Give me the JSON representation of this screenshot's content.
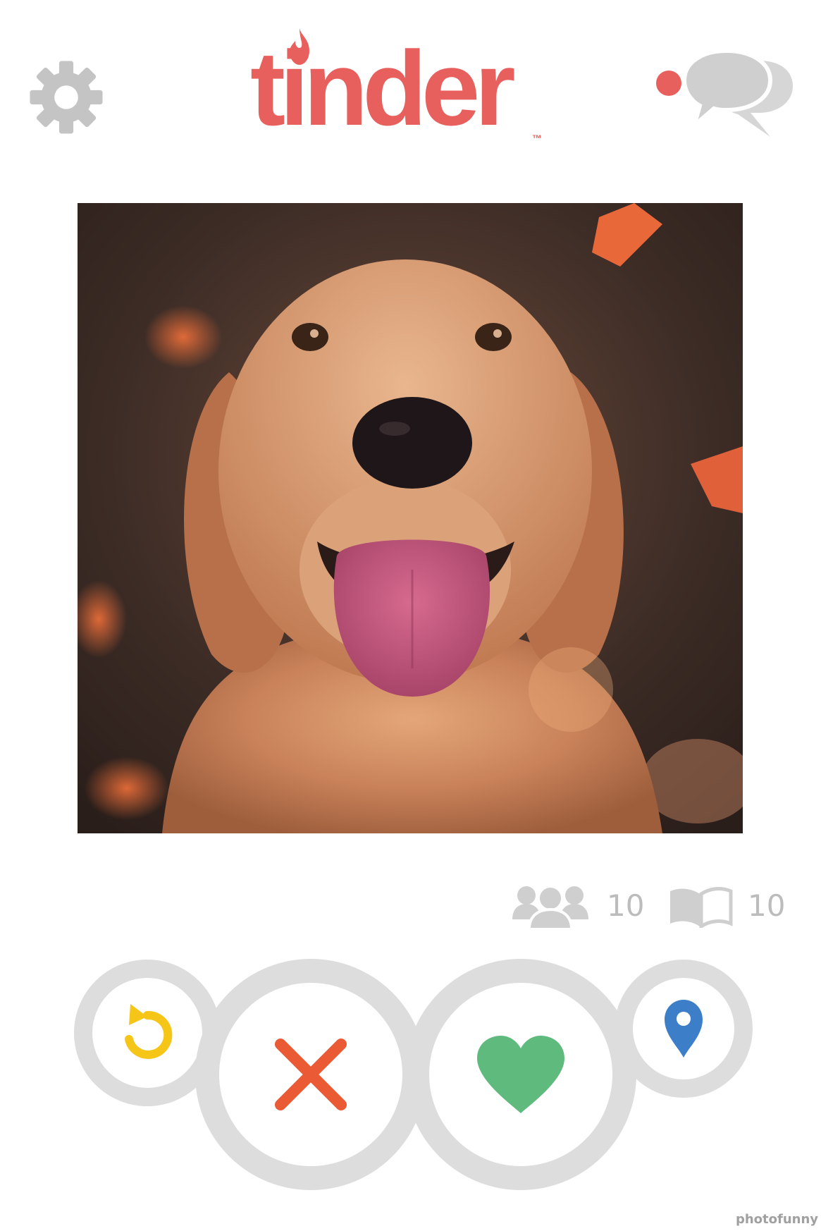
{
  "app": {
    "logo_text": "tinder",
    "logo_tm": "™"
  },
  "header": {
    "settings_icon": "gear-icon",
    "messages_icon": "chat-bubbles-icon",
    "has_notification": true
  },
  "profile": {
    "photo_subject": "golden retriever dog"
  },
  "stats": {
    "friends_count": "10",
    "interests_count": "10"
  },
  "actions": {
    "rewind_icon": "rewind-icon",
    "nope_icon": "x-icon",
    "like_icon": "heart-icon",
    "location_icon": "location-pin-icon"
  },
  "watermark": "photofunny",
  "colors": {
    "brand": "#e8605e",
    "rewind": "#f5c518",
    "nope": "#ea5a34",
    "like": "#5fba7d",
    "location": "#3d7ec9",
    "ring": "#dddddd",
    "icon_gray": "#c4c4c4"
  }
}
